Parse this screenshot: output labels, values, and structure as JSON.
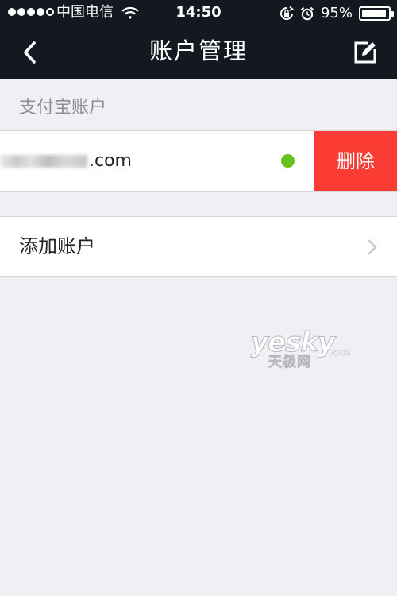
{
  "status_bar": {
    "carrier": "中国电信",
    "time": "14:50",
    "battery_percent": "95%",
    "battery_level": 0.95,
    "signal_bars_filled": 4,
    "signal_bars_total": 5,
    "icons": [
      "signal-icon",
      "wifi-icon",
      "rotation-lock-icon",
      "alarm-icon",
      "battery-icon"
    ]
  },
  "navbar": {
    "title": "账户管理",
    "back_icon": "chevron-left-icon",
    "edit_icon": "edit-icon"
  },
  "section": {
    "header": "支付宝账户"
  },
  "account": {
    "email_visible_suffix": ".com",
    "status_color": "#64c21e",
    "delete_label": "删除",
    "delete_color": "#fb3c35"
  },
  "add_account": {
    "label": "添加账户",
    "icon": "chevron-right-icon"
  },
  "watermark": {
    "brand": "yesky",
    "suffix": ".com",
    "subtitle": "天极网"
  },
  "colors": {
    "header_bg": "#141821",
    "page_bg": "#efeff4"
  }
}
